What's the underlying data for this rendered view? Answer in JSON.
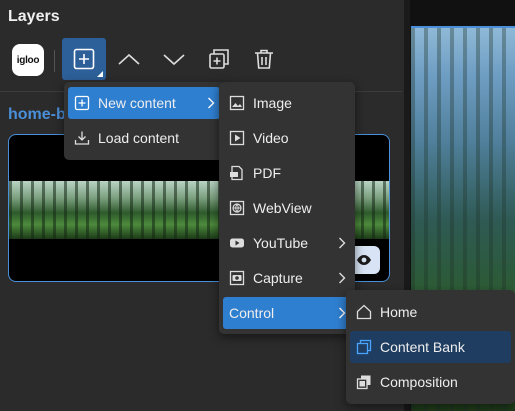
{
  "panel": {
    "title": "Layers"
  },
  "toolbar": {
    "logo_text": "igloo",
    "buttons": [
      {
        "icon": "add-icon"
      },
      {
        "icon": "chevron-up-icon"
      },
      {
        "icon": "chevron-down-icon"
      },
      {
        "icon": "duplicate-icon"
      },
      {
        "icon": "trash-icon"
      }
    ]
  },
  "layer": {
    "name": "home-b",
    "visibility_icon": "eye-icon"
  },
  "menu_main": {
    "items": [
      {
        "label": "New content",
        "icon": "add-icon",
        "highlighted": true,
        "submenu": true
      },
      {
        "label": "Load content",
        "icon": "download-icon",
        "highlighted": false,
        "submenu": false
      }
    ]
  },
  "menu_new_content": {
    "items": [
      {
        "label": "Image",
        "icon": "image-icon"
      },
      {
        "label": "Video",
        "icon": "play-icon"
      },
      {
        "label": "PDF",
        "icon": "pdf-icon"
      },
      {
        "label": "WebView",
        "icon": "globe-icon"
      },
      {
        "label": "YouTube",
        "icon": "youtube-icon",
        "submenu": true
      },
      {
        "label": "Capture",
        "icon": "capture-icon",
        "submenu": true
      },
      {
        "label": "Control",
        "icon": "",
        "submenu": true,
        "highlighted": true
      }
    ]
  },
  "menu_control": {
    "items": [
      {
        "label": "Home",
        "icon": "home-icon"
      },
      {
        "label": "Content Bank",
        "icon": "content-bank-icon",
        "highlighted": true
      },
      {
        "label": "Composition",
        "icon": "composition-icon"
      }
    ]
  },
  "colors": {
    "accent": "#2f7fd0",
    "selection": "#2d5f98",
    "layer_name": "#4a8fd9"
  }
}
